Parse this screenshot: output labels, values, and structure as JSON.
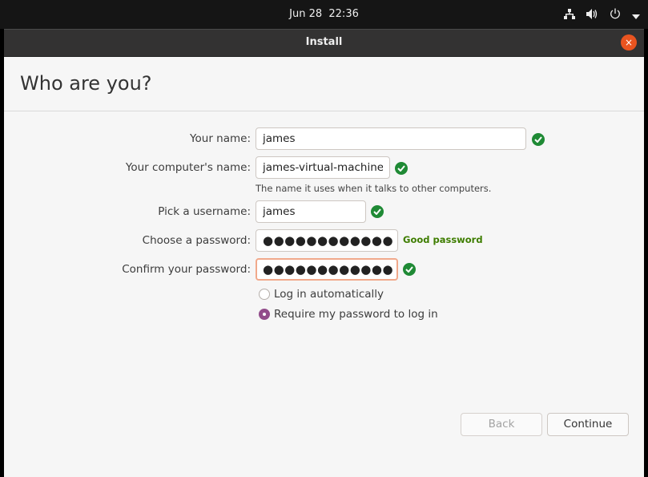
{
  "topbar": {
    "date": "Jun 28",
    "time": "22:36",
    "icons": [
      "network-wired-icon",
      "volume-icon",
      "power-icon",
      "menu-arrow-icon"
    ]
  },
  "window": {
    "title": "Install",
    "close_label": "×"
  },
  "page": {
    "heading": "Who are you?"
  },
  "form": {
    "name": {
      "label": "Your name:",
      "value": "james",
      "valid": true
    },
    "computer": {
      "label": "Your computer's name:",
      "value": "james-virtual-machine",
      "valid": true,
      "hint": "The name it uses when it talks to other computers."
    },
    "username": {
      "label": "Pick a username:",
      "value": "james",
      "valid": true
    },
    "password": {
      "label": "Choose a password:",
      "masked": "●●●●●●●●●●●●",
      "strength": "Good password"
    },
    "confirm": {
      "label": "Confirm your password:",
      "masked": "●●●●●●●●●●●●",
      "valid": true
    },
    "login_options": [
      {
        "label": "Log in automatically",
        "selected": false
      },
      {
        "label": "Require my password to log in",
        "selected": true
      }
    ]
  },
  "buttons": {
    "back": "Back",
    "continue": "Continue"
  },
  "colors": {
    "accent": "#e95420",
    "valid": "#1f8a35",
    "radio": "#924d8b",
    "strength": "#3e7d00"
  }
}
